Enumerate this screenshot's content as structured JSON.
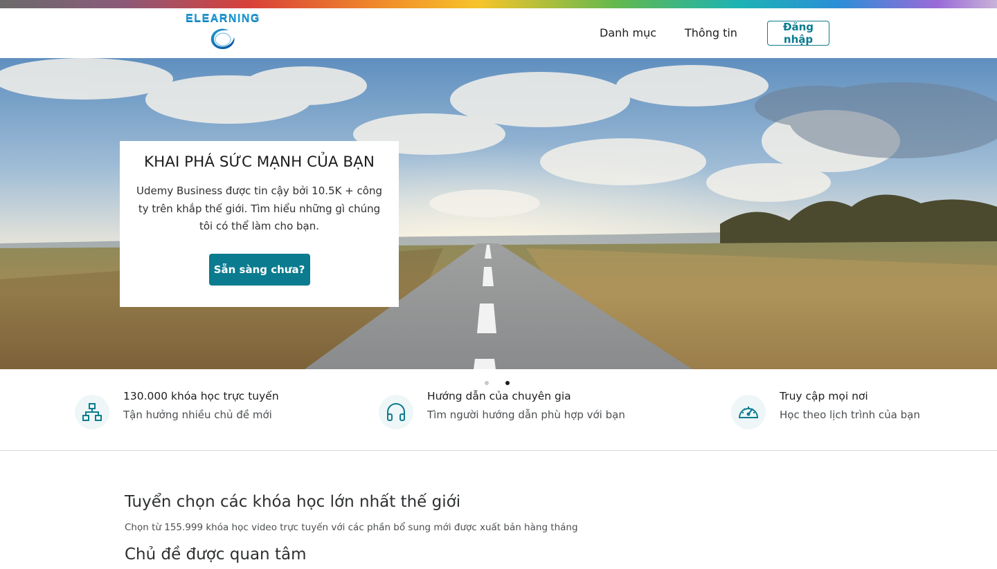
{
  "header": {
    "logo_text": "ELEARNING",
    "nav": {
      "categories": "Danh mục",
      "info": "Thông tin"
    },
    "login_label": "Đăng nhập"
  },
  "hero": {
    "title": "KHAI PHÁ SỨC MẠNH CỦA BẠN",
    "text": "Udemy Business được tin cậy bởi 10.5K + công ty trên khắp thế giới. Tìm hiểu những gì chúng tôi có thể làm cho bạn.",
    "cta_label": "Sẵn sàng chưa?",
    "slides_count": 2,
    "active_slide": 2
  },
  "features": [
    {
      "icon": "sitemap-icon",
      "title": "130.000 khóa học trực tuyến",
      "subtitle": "Tận hưởng nhiều chủ đề mới"
    },
    {
      "icon": "headphones-icon",
      "title": "Hướng dẫn của chuyên gia",
      "subtitle": "Tìm người hướng dẫn phù hợp với bạn"
    },
    {
      "icon": "speedometer-icon",
      "title": "Truy cập mọi nơi",
      "subtitle": "Học theo lịch trình của bạn"
    }
  ],
  "courses_section": {
    "title": "Tuyển chọn các khóa học lớn nhất thế giới",
    "subtitle": "Chọn từ 155.999 khóa học video trực tuyến với các phần bổ sung mới được xuất bản hàng tháng"
  },
  "topics_section": {
    "title": "Chủ đề được quan tâm"
  },
  "colors": {
    "accent": "#0b7b8f",
    "icon_bg": "#eef6f7",
    "text": "#1c1d1f"
  }
}
